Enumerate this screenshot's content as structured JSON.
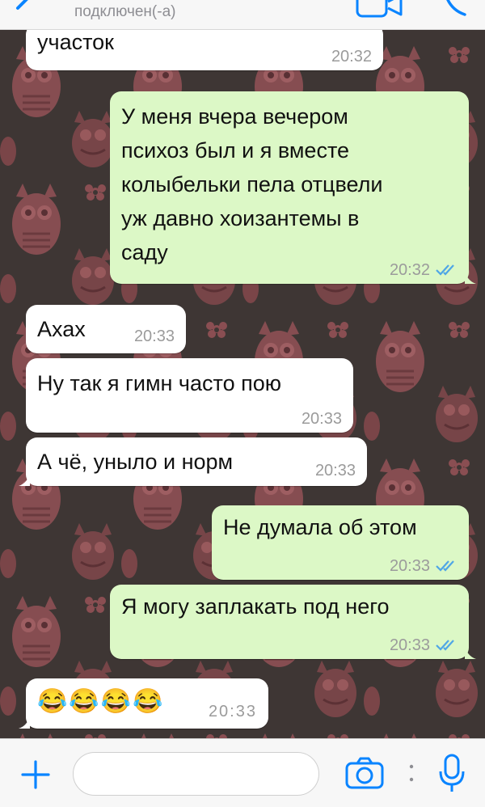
{
  "header": {
    "status": "подключен(-а)"
  },
  "messages": [
    {
      "dir": "in",
      "text": "участок",
      "time": "20:32"
    },
    {
      "dir": "out",
      "text": "У меня вчера вечером\nпсихоз был и я вместе\nколыбельки пела отцвели\nуж давно хоизантемы в\nсаду",
      "time": "20:32",
      "read": true
    },
    {
      "dir": "in",
      "text": "Ахах",
      "time": "20:33"
    },
    {
      "dir": "in",
      "text": "Ну так я гимн часто пою",
      "time": "20:33"
    },
    {
      "dir": "in",
      "text": "А чё, уныло и норм",
      "time": "20:33"
    },
    {
      "dir": "out",
      "text": "Не думала об этом",
      "time": "20:33",
      "read": true
    },
    {
      "dir": "out",
      "text": "Я могу заплакать под него",
      "time": "20:33",
      "read": true
    },
    {
      "dir": "in",
      "text": "😂😂😂😂",
      "time": "20:33"
    }
  ],
  "input": {
    "value": "",
    "placeholder": ""
  },
  "colors": {
    "accent": "#0a84ff",
    "incoming": "#ffffff",
    "outgoing": "#dcf8c6",
    "read_ticks": "#4fa6e6",
    "wallpaper_bg": "#3e3634",
    "wallpaper_owl": "#8a4e52"
  },
  "icons": {
    "back": "chevron-left-icon",
    "video": "video-camera-icon",
    "call": "phone-icon",
    "attach": "plus-icon",
    "camera": "camera-icon",
    "mic": "microphone-icon"
  }
}
